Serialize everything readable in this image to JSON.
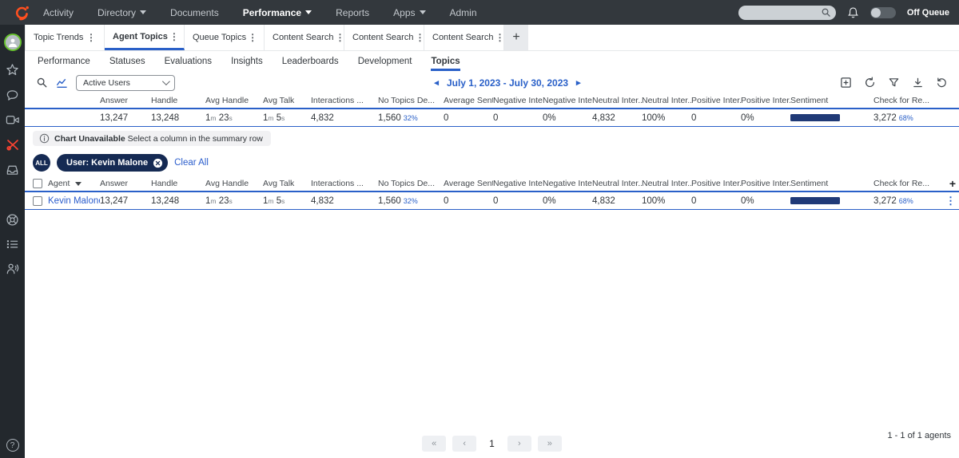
{
  "topnav": {
    "items": [
      {
        "label": "Activity"
      },
      {
        "label": "Directory"
      },
      {
        "label": "Documents"
      },
      {
        "label": "Performance"
      },
      {
        "label": "Reports"
      },
      {
        "label": "Apps"
      },
      {
        "label": "Admin"
      }
    ],
    "search_value": "",
    "off_queue_label": "Off Queue"
  },
  "tabs": {
    "items": [
      {
        "label": "Topic Trends"
      },
      {
        "label": "Agent Topics"
      },
      {
        "label": "Queue Topics"
      },
      {
        "label": "Content Search"
      },
      {
        "label": "Content Search"
      },
      {
        "label": "Content Search"
      }
    ],
    "kebab_glyph": "⋮",
    "add_label": "+"
  },
  "subtabs": [
    "Performance",
    "Statuses",
    "Evaluations",
    "Insights",
    "Leaderboards",
    "Development",
    "Topics"
  ],
  "toolbar": {
    "users_filter_value": "Active Users",
    "date_range": "July 1, 2023 - July 30, 2023",
    "prev_glyph": "◂",
    "next_glyph": "▸"
  },
  "summary_table": {
    "headers": [
      "Answer",
      "Handle",
      "Avg Handle",
      "Avg Talk",
      "Interactions ...",
      "No Topics De...",
      "Average Sent...",
      "Negative Inte...",
      "Negative Inte...",
      "Neutral Inter...",
      "Neutral Inter...",
      "Positive Inter...",
      "Positive Inter...",
      "Sentiment",
      "Check for Re..."
    ],
    "row": {
      "answer": "13,247",
      "handle": "13,248",
      "avg_handle": [
        "1",
        "m",
        "23",
        "s"
      ],
      "avg_talk": [
        "1",
        "m",
        "5",
        "s"
      ],
      "interactions": "4,832",
      "no_topics": "1,560",
      "no_topics_pct": "32%",
      "avg_sentiment": "0",
      "neg_count": "0",
      "neg_pct": "0%",
      "neu_count": "4,832",
      "neu_pct": "100%",
      "pos_count": "0",
      "pos_pct": "0%",
      "check": "3,272",
      "check_pct": "68%"
    }
  },
  "chart_notice": {
    "title": "Chart Unavailable",
    "message": "Select a column in the summary row"
  },
  "filters": {
    "all_label": "ALL",
    "chips": [
      {
        "label": "User: Kevin Malone"
      }
    ],
    "clear_all_label": "Clear All"
  },
  "agent_table": {
    "headers": [
      "Agent",
      "Answer",
      "Handle",
      "Avg Handle",
      "Avg Talk",
      "Interactions ...",
      "No Topics De...",
      "Average Sent...",
      "Negative Inte...",
      "Negative Inte...",
      "Neutral Inter...",
      "Neutral Inter...",
      "Positive Inter...",
      "Positive Inter...",
      "Sentiment",
      "Check for Re..."
    ],
    "add_label": "+",
    "kebab_glyph": "⋮",
    "rows": [
      {
        "agent": "Kevin Malone",
        "answer": "13,247",
        "handle": "13,248",
        "avg_handle": [
          "1",
          "m",
          "23",
          "s"
        ],
        "avg_talk": [
          "1",
          "m",
          "5",
          "s"
        ],
        "interactions": "4,832",
        "no_topics": "1,560",
        "no_topics_pct": "32%",
        "avg_sentiment": "0",
        "neg_count": "0",
        "neg_pct": "0%",
        "neu_count": "4,832",
        "neu_pct": "100%",
        "pos_count": "0",
        "pos_pct": "0%",
        "check": "3,272",
        "check_pct": "68%"
      }
    ]
  },
  "pagination": {
    "first_glyph": "«",
    "prev_glyph": "‹",
    "page": "1",
    "next_glyph": "›",
    "last_glyph": "»",
    "count_text": "1 - 1 of 1 agents"
  },
  "help_glyph": "?"
}
